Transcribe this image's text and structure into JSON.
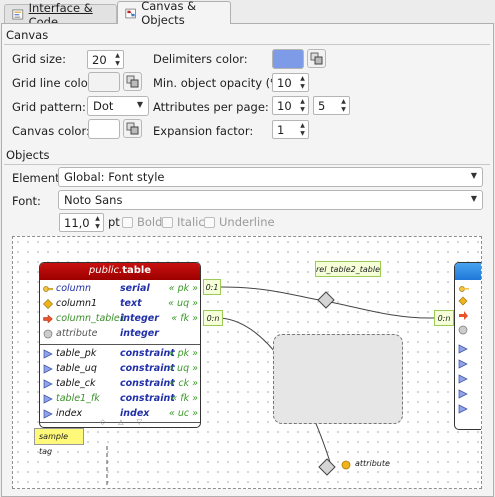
{
  "tabs": [
    {
      "label": "Interface & Code",
      "icon": "code-doc-icon",
      "active": false
    },
    {
      "label": "Canvas & Objects",
      "icon": "canvas-icon",
      "active": true
    }
  ],
  "canvas_section": {
    "title": "Canvas",
    "grid_size": {
      "label": "Grid size:",
      "value": "20"
    },
    "grid_line_color": {
      "label": "Grid line color:",
      "color": "#f2f2f2"
    },
    "grid_pattern": {
      "label": "Grid pattern:",
      "value": "Dot"
    },
    "canvas_color": {
      "label": "Canvas color:",
      "color": "#ffffff"
    },
    "delimiters_color": {
      "label": "Delimiters color:",
      "color": "#7d9be6"
    },
    "min_object_opacity": {
      "label": "Min. object opacity (%):",
      "value": "10"
    },
    "attributes_per_page": {
      "label": "Attributes per page:",
      "value1": "10",
      "value2": "5"
    },
    "expansion_factor": {
      "label": "Expansion factor:",
      "value": "1"
    }
  },
  "objects_section": {
    "title": "Objects",
    "element": {
      "label": "Element:",
      "value": "Global: Font style"
    },
    "font": {
      "label": "Font:",
      "value": "Noto Sans"
    },
    "size": {
      "value": "11,0",
      "unit": "pt"
    },
    "bold_label": "Bold",
    "italic_label": "Italic",
    "underline_label": "Underline"
  },
  "preview": {
    "table": {
      "schema": "public.",
      "name": "table",
      "columns": [
        {
          "name": "column",
          "type": "serial",
          "constraint": "« pk »",
          "icon": "pk-key-icon",
          "style": "blue"
        },
        {
          "name": "column1",
          "type": "text",
          "constraint": "« uq »",
          "icon": "uq-diamond-icon",
          "style": "black"
        },
        {
          "name": "column_table1",
          "type": "integer",
          "constraint": "« fk »",
          "icon": "fk-arrow-icon",
          "style": "green"
        },
        {
          "name": "attribute",
          "type": "integer",
          "constraint": "",
          "icon": "column-circle-icon",
          "style": "gray"
        }
      ],
      "constraints": [
        {
          "name": "table_pk",
          "type": "constraint",
          "constraint": "« pk »",
          "style": "black"
        },
        {
          "name": "table_uq",
          "type": "constraint",
          "constraint": "« uq »",
          "style": "black"
        },
        {
          "name": "table_ck",
          "type": "constraint",
          "constraint": "« ck »",
          "style": "black"
        },
        {
          "name": "table1_fk",
          "type": "constraint",
          "constraint": "« fk »",
          "style": "green"
        },
        {
          "name": "index",
          "type": "index",
          "constraint": "« uc »",
          "style": "black"
        }
      ]
    },
    "cardinality_1": "0:1",
    "cardinality_2": "0:n",
    "cardinality_3": "0:n",
    "relationship_label": "rel_table2_table",
    "attribute_label": "attribute",
    "tag_label": "sample tag"
  }
}
